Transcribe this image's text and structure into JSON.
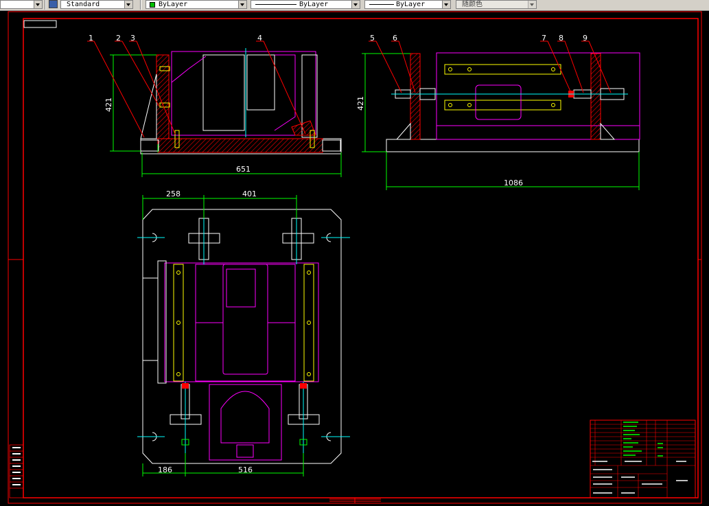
{
  "toolbar": {
    "textstyle_value": "Standard",
    "color_value": "ByLayer",
    "linetype_value": "ByLayer",
    "lineweight_value": "ByLayer",
    "plotstyle_value": "随颜色"
  },
  "drawing": {
    "balloons": [
      "1",
      "2",
      "3",
      "4",
      "5",
      "6",
      "7",
      "8",
      "9"
    ],
    "dimensions": {
      "front_height": "421",
      "front_width": "651",
      "side_height": "421",
      "side_width": "1086",
      "top_left": "258",
      "top_middle": "401",
      "bottom_left": "186",
      "bottom_middle": "516"
    }
  },
  "colors": {
    "border": "#ff0000",
    "outline": "#ffffff",
    "part": "#ff00ff",
    "hatch": "#ff0000",
    "dimension": "#00ff00",
    "centerline": "#00ffff",
    "highlight": "#ffff00"
  }
}
